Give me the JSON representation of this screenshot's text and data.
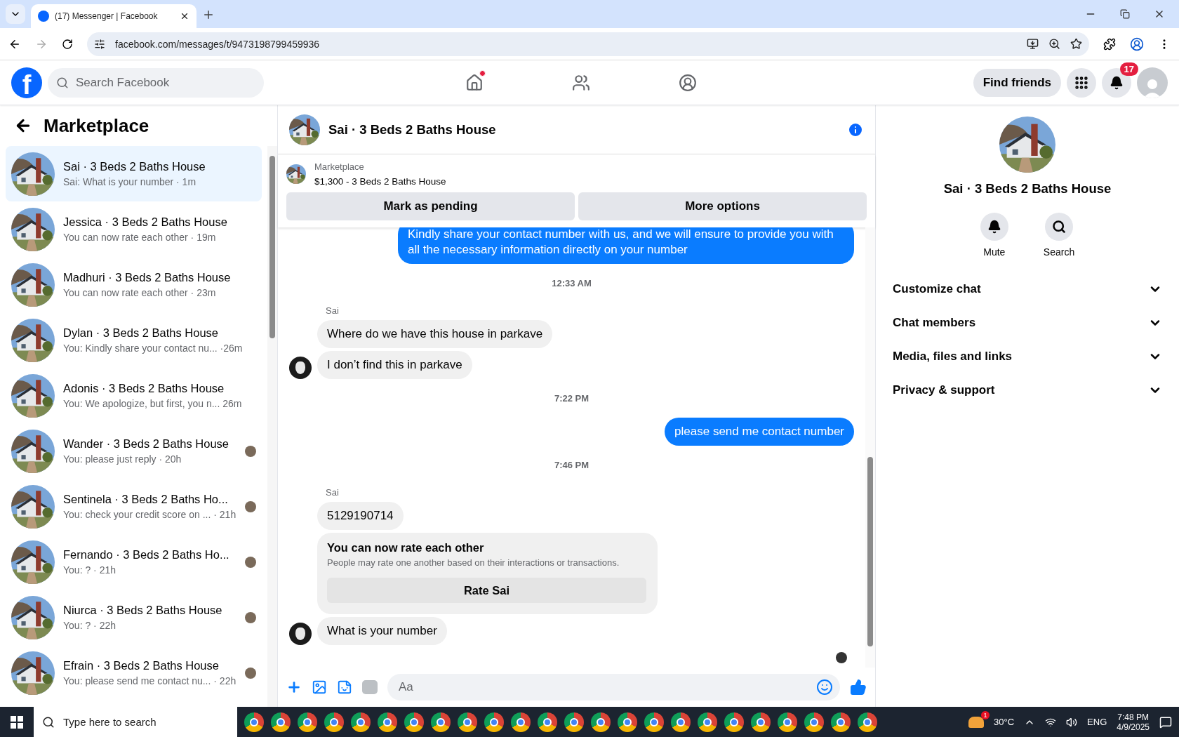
{
  "browser": {
    "tab": {
      "title": "(17) Messenger | Facebook",
      "selected": true
    },
    "url": "facebook.com/messages/t/9473198799459936"
  },
  "topnav": {
    "logo": "f",
    "search": {
      "placeholder": "Search Facebook"
    },
    "nav_icons": [
      {
        "kind": "home",
        "dot": true
      },
      {
        "kind": "friends",
        "dot": false
      },
      {
        "kind": "groups",
        "dot": false
      }
    ],
    "find_friends": "Find friends",
    "notifications_badge": "17"
  },
  "sidebar": {
    "title": "Marketplace",
    "conversations": [
      {
        "name": "Sai · 3 Beds 2 Baths House",
        "preview": "Sai: What is your number · 1m",
        "selected": true,
        "seen": false
      },
      {
        "name": "Jessica · 3 Beds 2 Baths House",
        "preview": "You can now rate each other · 19m",
        "selected": false,
        "seen": false
      },
      {
        "name": "Madhuri · 3 Beds 2 Baths House",
        "preview": "You can now rate each other · 23m",
        "selected": false,
        "seen": false
      },
      {
        "name": "Dylan · 3 Beds 2 Baths House",
        "preview": "You: Kindly share your contact nu... ·26m",
        "selected": false,
        "seen": false
      },
      {
        "name": "Adonis · 3 Beds 2 Baths House",
        "preview": "You: We apologize, but first, you n... 26m",
        "selected": false,
        "seen": false
      },
      {
        "name": "Wander · 3 Beds 2 Baths House",
        "preview": "You: please just reply · 20h",
        "selected": false,
        "seen": true
      },
      {
        "name": "Sentinela · 3 Beds 2 Baths Ho...",
        "preview": "You: check your credit score on ... · 21h",
        "selected": false,
        "seen": true
      },
      {
        "name": "Fernando · 3 Beds 2 Baths Ho...",
        "preview": "You: ? · 21h",
        "selected": false,
        "seen": true
      },
      {
        "name": "Niurca · 3 Beds 2 Baths House",
        "preview": "You: ? · 22h",
        "selected": false,
        "seen": true
      },
      {
        "name": "Efrain · 3 Beds 2 Baths House",
        "preview": "You: please send me contact nu... · 22h",
        "selected": false,
        "seen": true
      }
    ]
  },
  "chat": {
    "title": "Sai · 3 Beds 2 Baths House",
    "listing": {
      "label": "Marketplace",
      "title": "$1,300 - 3 Beds 2 Baths House",
      "buttons": [
        "Mark as pending",
        "More options"
      ]
    },
    "messages": [
      {
        "kind": "outgoing",
        "text": "Kindly share your contact number with us, and we will ensure to provide you with all the necessary information directly on your number"
      },
      {
        "kind": "time",
        "text": "12:33 AM"
      },
      {
        "kind": "sender",
        "text": "Sai"
      },
      {
        "kind": "incoming",
        "text": "Where do we have this house in parkave",
        "avatar": false
      },
      {
        "kind": "incoming",
        "text": "I don’t find this in parkave",
        "avatar": true
      },
      {
        "kind": "time",
        "text": "7:22 PM"
      },
      {
        "kind": "outgoing",
        "text": "please send me contact number"
      },
      {
        "kind": "time",
        "text": "7:46 PM"
      },
      {
        "kind": "sender",
        "text": "Sai"
      },
      {
        "kind": "incoming",
        "text": "5129190714",
        "avatar": false
      },
      {
        "kind": "rating_card",
        "title": "You can now rate each other",
        "description": "People may rate one another based on their interactions or transactions.",
        "button": "Rate Sai"
      },
      {
        "kind": "incoming",
        "text": "What is your number",
        "avatar": true
      },
      {
        "kind": "seen"
      }
    ],
    "composer": {
      "placeholder": "Aa"
    }
  },
  "details": {
    "name": "Sai · 3 Beds 2 Baths House",
    "actions": [
      {
        "kind": "mute",
        "label": "Mute"
      },
      {
        "kind": "search",
        "label": "Search"
      }
    ],
    "sections": [
      "Customize chat",
      "Chat members",
      "Media, files and links",
      "Privacy & support"
    ]
  },
  "taskbar": {
    "search": {
      "placeholder": "Type here to search"
    },
    "weather_badge": "1",
    "temperature": "30°C",
    "language": "ENG",
    "time": "7:48 PM",
    "date": "4/9/2025"
  }
}
